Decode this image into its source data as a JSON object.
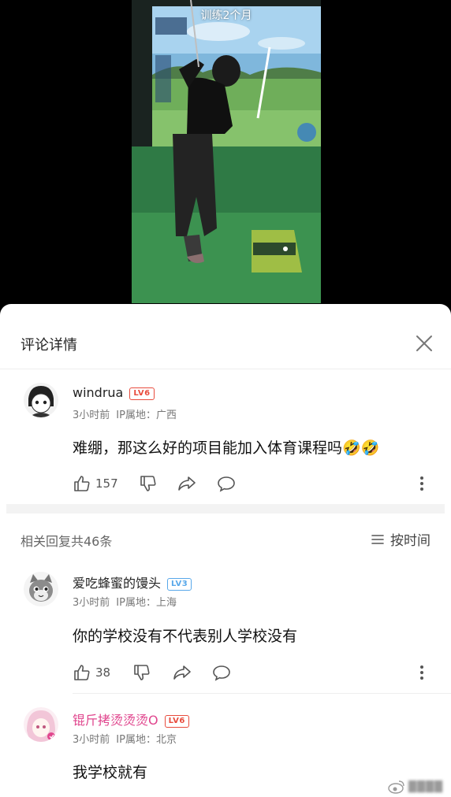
{
  "video": {
    "caption": "训练2个月"
  },
  "sheet": {
    "title": "评论详情"
  },
  "main_comment": {
    "username": "windrua",
    "level": "LV6",
    "time": "3小时前",
    "location": "IP属地：广西",
    "text": "难绷，那这么好的项目能加入体育课程吗🤣🤣",
    "likes": "157"
  },
  "replies": {
    "count_label": "相关回复共46条",
    "sort_label": "按时间",
    "items": [
      {
        "username": "爱吃蜂蜜的馒头",
        "level": "LV3",
        "time": "3小时前",
        "location": "IP属地：上海",
        "text": "你的学校没有不代表别人学校没有",
        "likes": "38"
      },
      {
        "username": "锟斤拷烫烫烫O",
        "level": "LV6",
        "time": "3小时前",
        "location": "IP属地：北京",
        "text": "我学校就有"
      }
    ]
  },
  "colors": {
    "pink_username": "#e0458d",
    "lv6": "#e84c3d",
    "lv3": "#58a8ea"
  }
}
